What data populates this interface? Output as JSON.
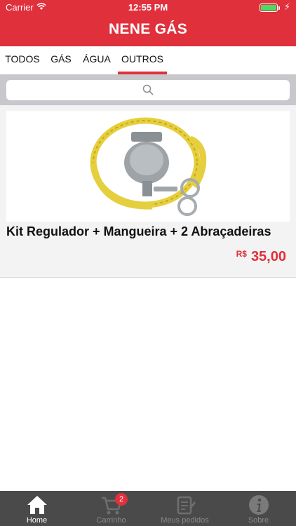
{
  "status_bar": {
    "carrier": "Carrier",
    "time": "12:55 PM"
  },
  "header": {
    "title": "NENE GÁS"
  },
  "tabs": [
    {
      "label": "TODOS",
      "active": false
    },
    {
      "label": "GÁS",
      "active": false
    },
    {
      "label": "ÁGUA",
      "active": false
    },
    {
      "label": "OUTROS",
      "active": true
    }
  ],
  "search": {
    "placeholder": "",
    "value": ""
  },
  "products": [
    {
      "name": "Kit Regulador + Mangueira + 2 Abraçadeiras",
      "currency": "R$",
      "price": "35,00"
    }
  ],
  "tab_bar": [
    {
      "label": "Home",
      "icon": "home-icon",
      "active": true
    },
    {
      "label": "Carrinho",
      "icon": "cart-icon",
      "badge": "2",
      "active": false
    },
    {
      "label": "Meus pedidos",
      "icon": "orders-icon",
      "active": false
    },
    {
      "label": "Sobre",
      "icon": "info-icon",
      "active": false
    }
  ],
  "colors": {
    "brand": "#e0303c",
    "tab_bar_bg": "#4a4a4a",
    "search_bg": "#c8c7cc"
  }
}
